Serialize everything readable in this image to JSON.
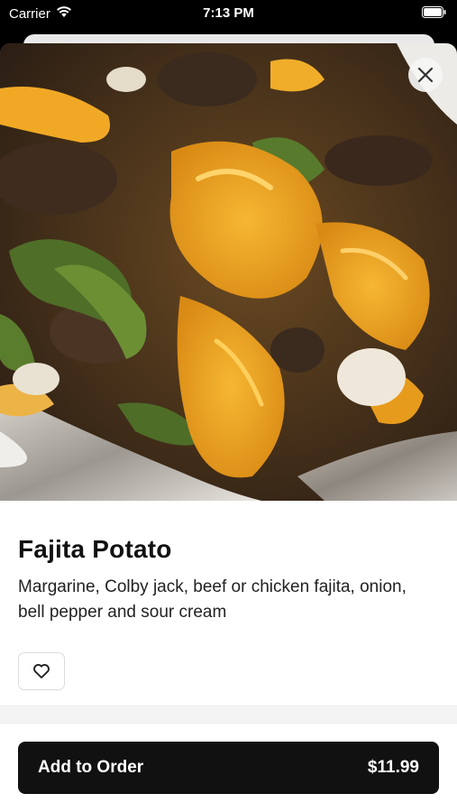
{
  "status_bar": {
    "carrier": "Carrier",
    "time": "7:13 PM",
    "icons": [
      "wifi-icon",
      "battery-icon"
    ]
  },
  "hero_image": {
    "alt": "Fajita Potato photo"
  },
  "item": {
    "title": "Fajita Potato",
    "description": "Margarine, Colby jack, beef or chicken fajita, onion, bell pepper and sour cream"
  },
  "actions": {
    "close_icon": "close-icon",
    "favorite_icon": "heart-icon"
  },
  "order_button": {
    "label": "Add to Order",
    "price": "$11.99"
  },
  "colors": {
    "primary_button": "#111111",
    "background": "#ffffff"
  }
}
